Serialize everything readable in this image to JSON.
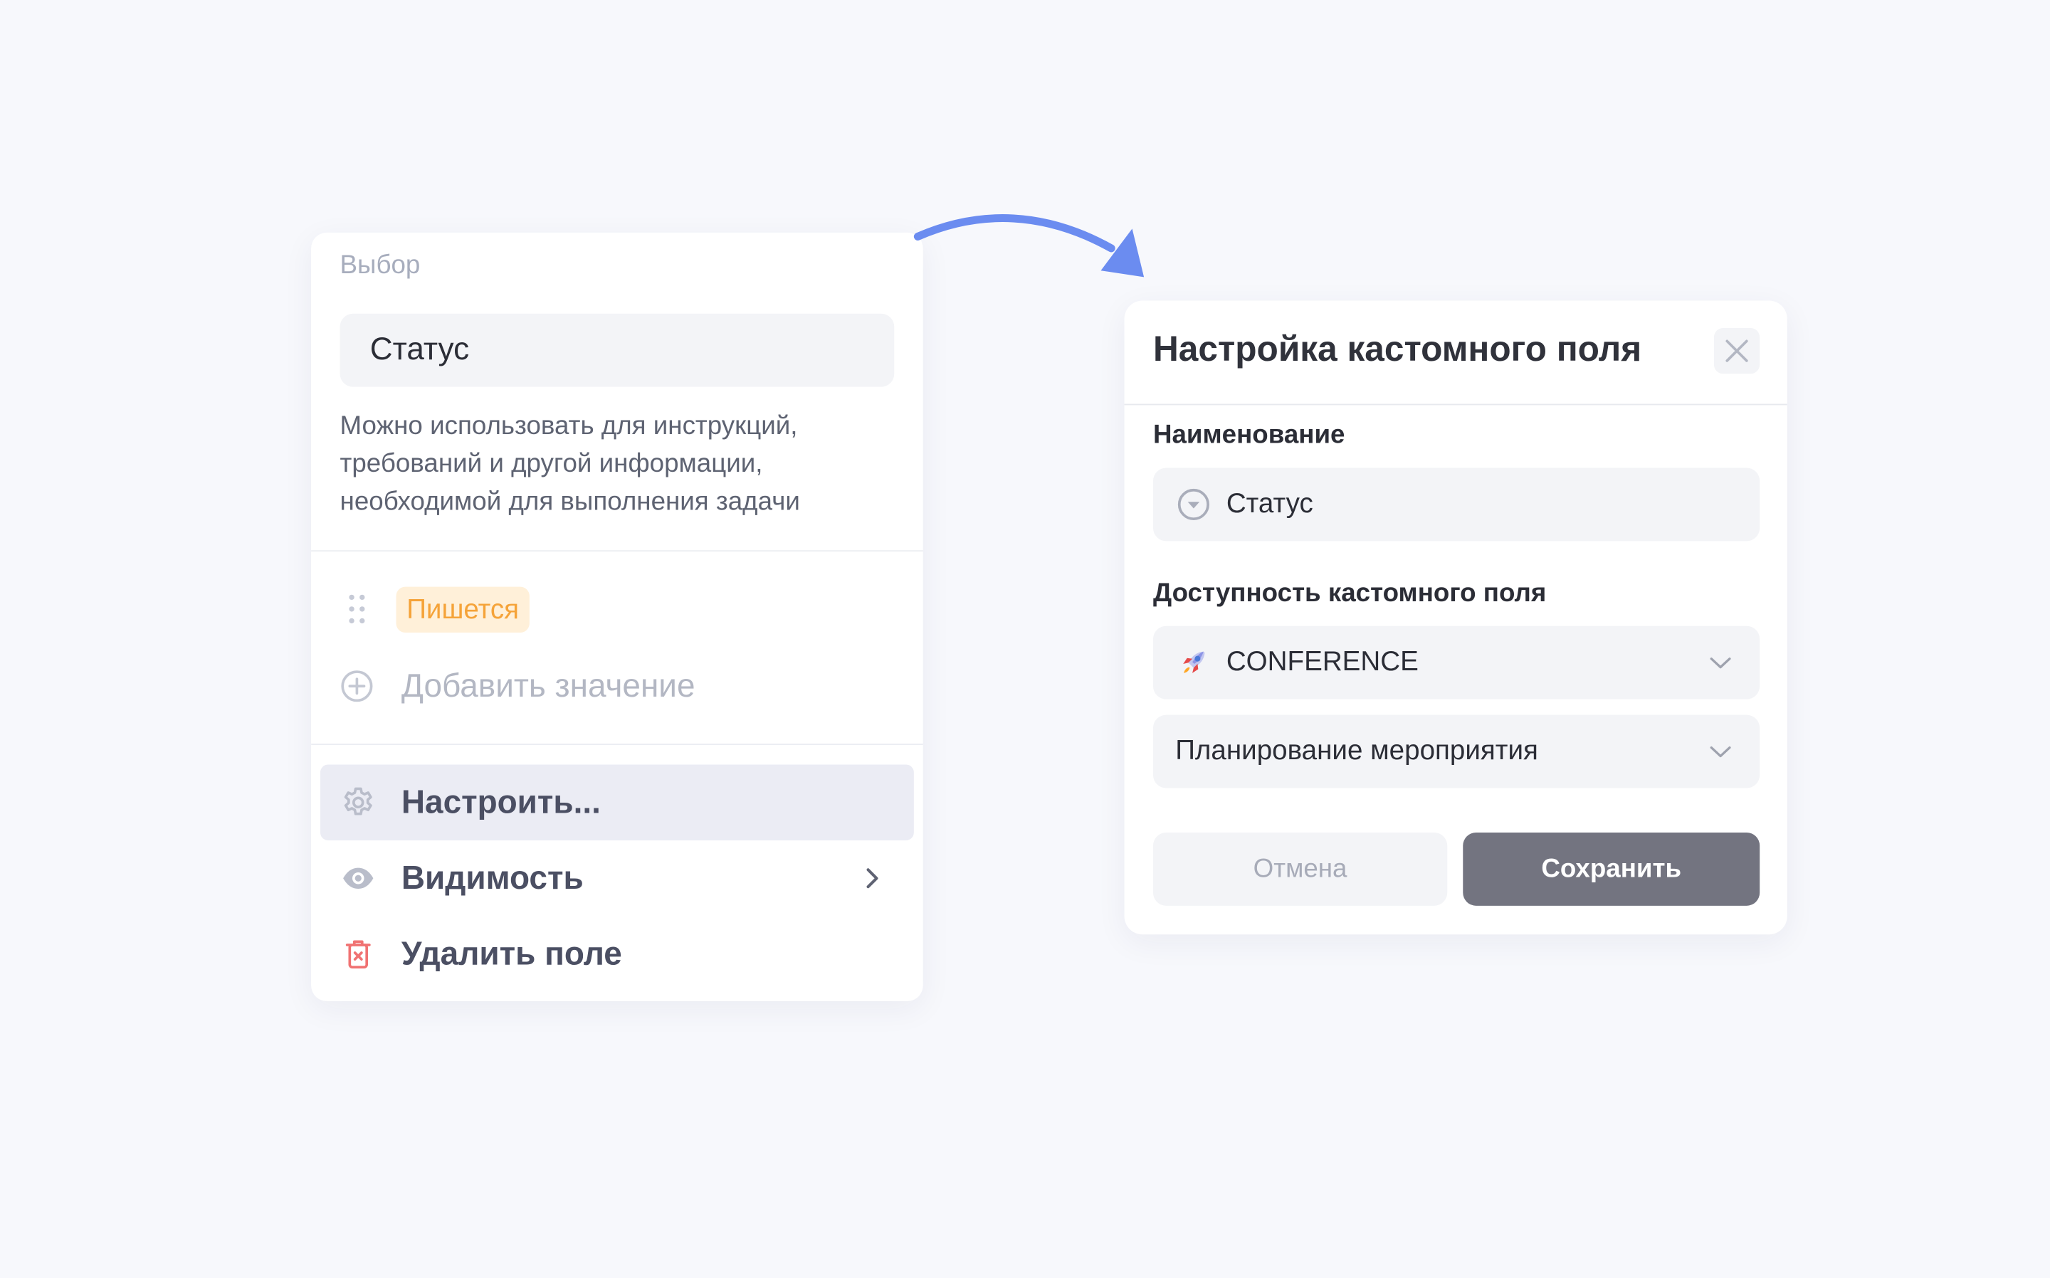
{
  "field_menu": {
    "type_label": "Выбор",
    "field_name": "Статус",
    "description": "Можно использовать для инструкций, требований и другой информации, необходимой для выполнения задачи",
    "values": [
      {
        "label": "Пишется",
        "color": "#f5a339",
        "background": "#fff0d9"
      }
    ],
    "add_value_label": "Добавить значение",
    "menu": {
      "configure_label": "Настроить...",
      "visibility_label": "Видимость",
      "delete_label": "Удалить поле"
    }
  },
  "dialog": {
    "title": "Настройка кастомного поля",
    "name_label": "Наименование",
    "name_value": "Статус",
    "availability_label": "Доступность кастомного поля",
    "project_value": "CONFERENCE",
    "board_value": "Планирование мероприятия",
    "cancel_label": "Отмена",
    "save_label": "Сохранить"
  },
  "icons": {
    "drag": "drag-handle-icon",
    "add": "plus-circle-icon",
    "configure": "gear-icon",
    "visibility": "eye-icon",
    "visibility_arrow": "chevron-right-icon",
    "delete": "trash-icon",
    "close": "close-icon",
    "field_type": "select-field-icon",
    "project": "rocket-icon",
    "dropdown": "chevron-down-icon"
  },
  "colors": {
    "accent_arrow": "#6b8cf0",
    "danger": "#f07272",
    "save_button": "#737480",
    "active_menu_bg": "#ebecf4"
  }
}
